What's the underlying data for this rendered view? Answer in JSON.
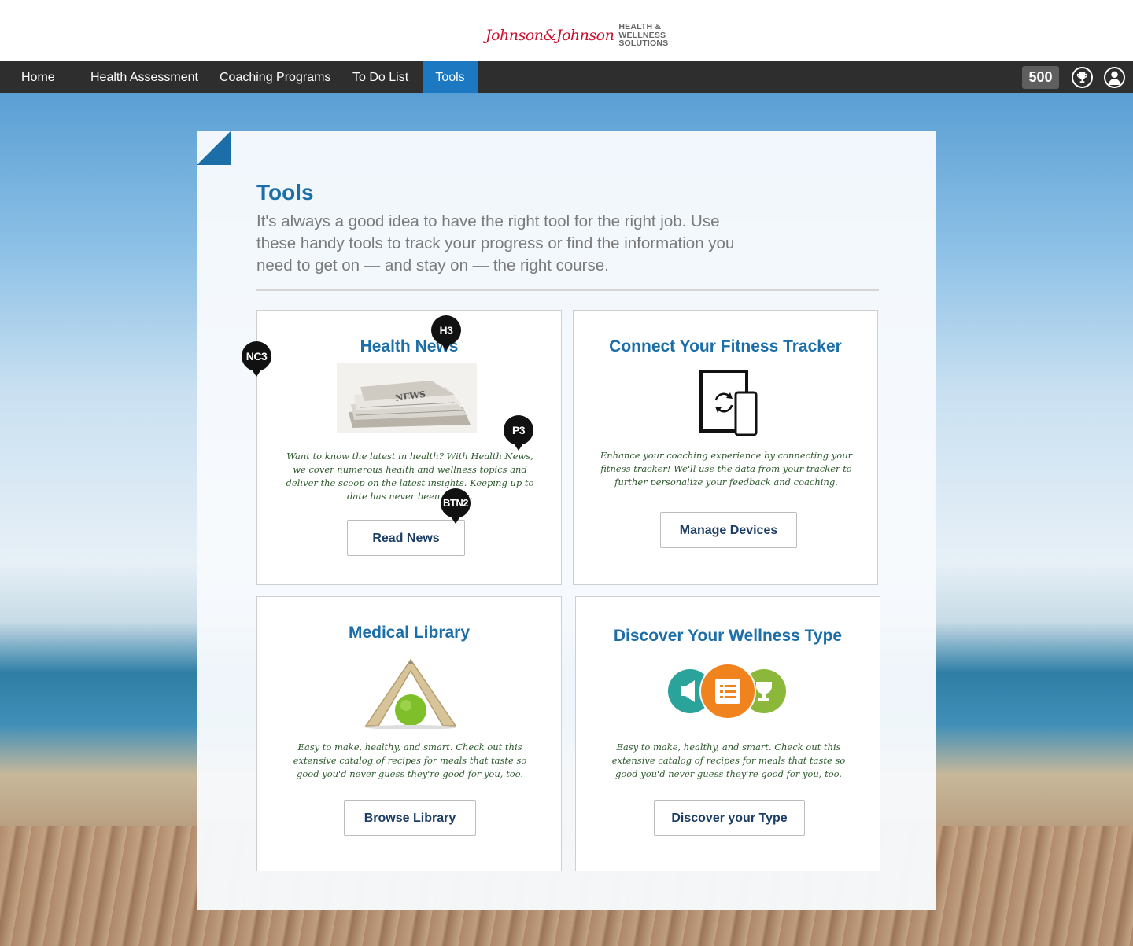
{
  "brand": {
    "logo_script": "Johnson&Johnson",
    "line1": "HEALTH &",
    "line2": "WELLNESS",
    "line3": "SOLUTIONS"
  },
  "nav": {
    "items": [
      {
        "label": "Home"
      },
      {
        "label": "Health Assessment"
      },
      {
        "label": "Coaching Programs"
      },
      {
        "label": "To Do List"
      },
      {
        "label": "Tools"
      }
    ],
    "active": "Tools",
    "points": "500",
    "trophy_icon": "trophy-icon",
    "profile_icon": "user-icon"
  },
  "page": {
    "title": "Tools",
    "intro": "It's always a good idea to have the right tool for the right job. Use these handy tools to track your progress or find the information you need to get on — and stay on — the right course."
  },
  "tools": [
    {
      "title": "Health News",
      "description": "Want to know the latest in health? With Health News, we cover numerous health and wellness topics and deliver the scoop on the latest insights. Keeping up to date has never been easier.",
      "button": "Read News",
      "image": "newspaper-stack-image"
    },
    {
      "title": "Connect Your Fitness Tracker",
      "description": "Enhance your coaching experience by connecting your fitness tracker! We'll use the data from your tracker to further personalize your feedback and coaching.",
      "button": "Manage Devices",
      "image": "device-sync-icon"
    },
    {
      "title": "Medical Library",
      "description": "Easy to make, healthy, and smart. Check out this extensive catalog of recipes for meals that taste so good you'd never guess they're good for you, too.",
      "button": "Browse Library",
      "image": "book-over-apple-image"
    },
    {
      "title": "Discover Your Wellness Type",
      "description": "Easy to make, healthy, and smart. Check out this extensive catalog of recipes for meals that taste so good you'd never guess they're good for you, too.",
      "button": "Discover your Type",
      "image": "wellness-type-icons"
    }
  ],
  "markers": {
    "nc3": "NC3",
    "h3": "H3",
    "p3": "P3",
    "btn2": "BTN2"
  },
  "colors": {
    "nav_bg": "#2e2e2e",
    "nav_active": "#1b78c1",
    "title_blue": "#1b6ea8",
    "button_text": "#1d3f66",
    "desc_green": "#2d5a2d",
    "brand_red": "#c8102e"
  }
}
